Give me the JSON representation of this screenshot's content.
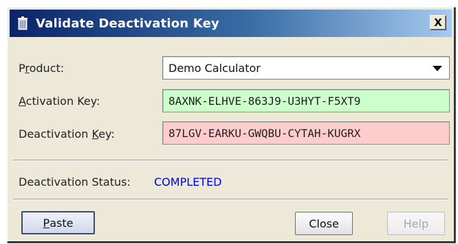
{
  "window": {
    "title": "Validate Deactivation Key",
    "close_glyph": "X",
    "app_icon": "trash-can-icon"
  },
  "form": {
    "product": {
      "label_mnemonic": "r",
      "label_pre": "P",
      "label_post": "oduct:",
      "value": "Demo Calculator"
    },
    "activation_key": {
      "label_mnemonic": "A",
      "label_pre": "",
      "label_post": "ctivation Key:",
      "value": "8AXNK-ELHVE-863J9-U3HYT-F5XT9",
      "bg_color": "#ccffcc"
    },
    "deactivation_key": {
      "label_mnemonic": "K",
      "label_pre": "Deactivation ",
      "label_post": "ey:",
      "value": "87LGV-EARKU-GWQBU-CYTAH-KUGRX",
      "bg_color": "#ffcccc"
    }
  },
  "status": {
    "label": "Deactivation Status:",
    "value": "COMPLETED",
    "value_color": "#0000ee"
  },
  "buttons": {
    "paste": {
      "mnemonic": "P",
      "rest": "aste"
    },
    "close": "Close",
    "help": "Help"
  },
  "colors": {
    "titlebar_start": "#0a246a",
    "titlebar_end": "#a6caf0",
    "dialog_bg": "#ece9d8"
  }
}
